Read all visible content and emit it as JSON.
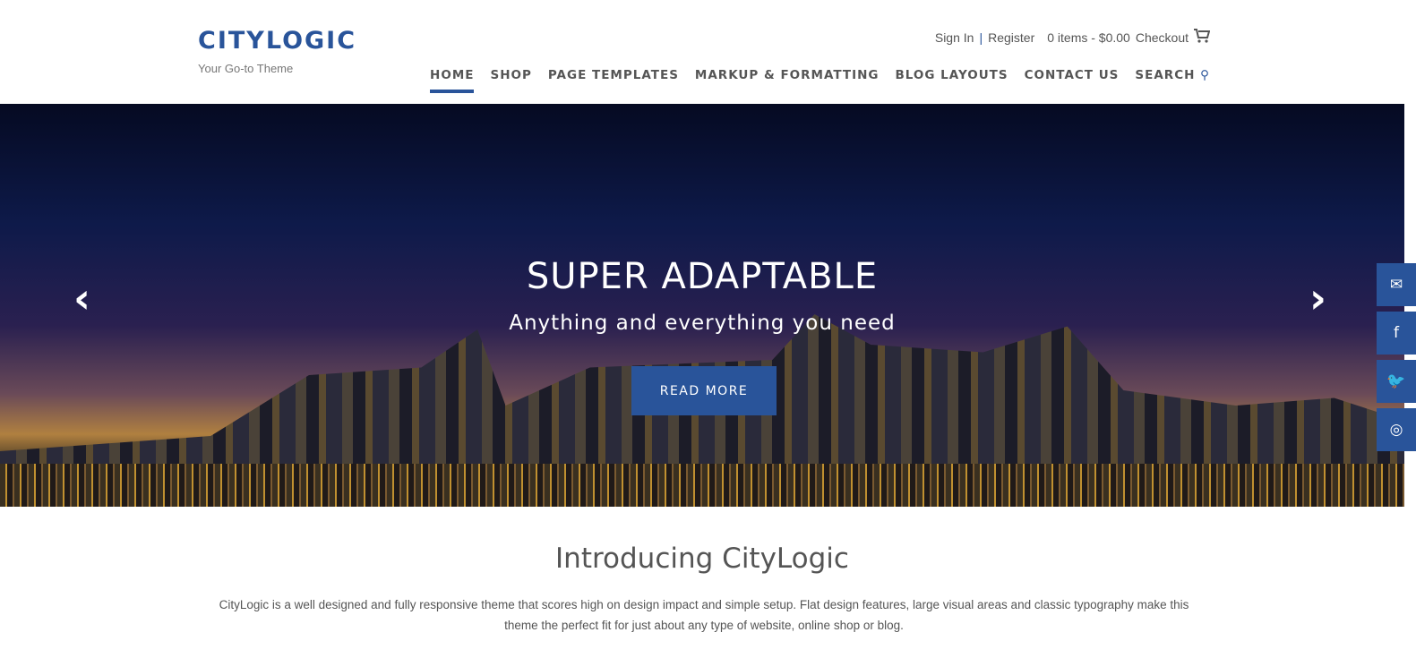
{
  "header": {
    "logo": "CITYLOGIC",
    "tagline": "Your Go-to Theme",
    "sign_in": "Sign In",
    "separator": "|",
    "register": "Register",
    "cart_summary": "0 items - $0.00",
    "checkout": "Checkout"
  },
  "nav": [
    "HOME",
    "SHOP",
    "PAGE TEMPLATES",
    "MARKUP & FORMATTING",
    "BLOG LAYOUTS",
    "CONTACT US",
    "SEARCH"
  ],
  "hero": {
    "title": "SUPER ADAPTABLE",
    "subtitle": "Anything and everything you need",
    "button": "READ MORE",
    "prev": "‹",
    "next": "›"
  },
  "social": [
    "✉",
    "f",
    "🐦",
    "◎"
  ],
  "intro": {
    "title": "Introducing CityLogic",
    "text": "CityLogic is a well designed and fully responsive theme that scores high on design impact and simple setup. Flat design features, large visual areas and classic typography make this theme the perfect fit for just about any type of website, online shop or blog."
  },
  "colors": {
    "accent": "#29549a"
  }
}
